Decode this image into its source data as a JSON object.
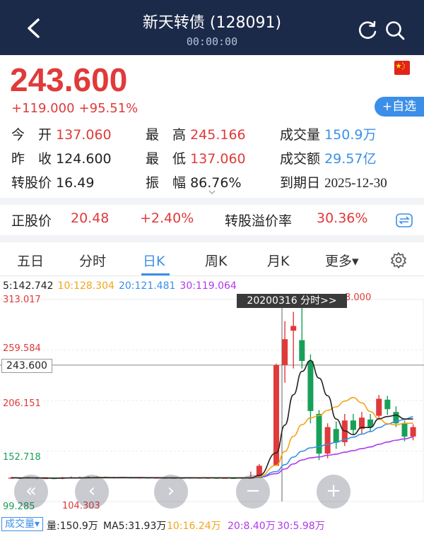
{
  "header": {
    "title": "新天转债 (128091)",
    "subtitle": "00:00:00"
  },
  "quote": {
    "price": "243.600",
    "change": "+119.000",
    "change_pct": "+95.51%",
    "watch_label": "+自选"
  },
  "stats": {
    "open_label": "今　开",
    "open": "137.060",
    "high_label": "最　高",
    "high": "245.166",
    "volume_label": "成交量",
    "volume": "150.9万",
    "prev_label": "昨　收",
    "prev": "124.600",
    "low_label": "最　低",
    "low": "137.060",
    "amount_label": "成交额",
    "amount": "29.57亿",
    "conv_label": "转股价",
    "conv": "16.49",
    "amp_label": "振　幅",
    "amp": "86.76%",
    "expire_label": "到期日",
    "expire": "2025-12-30"
  },
  "stock": {
    "label": "正股价",
    "price": "20.48",
    "pct": "+2.40%",
    "premium_label": "转股溢价率",
    "premium": "30.36%"
  },
  "tabs": [
    {
      "label": "五日"
    },
    {
      "label": "分时"
    },
    {
      "label": "日K"
    },
    {
      "label": "周K"
    },
    {
      "label": "月K"
    },
    {
      "label": "更多▾"
    }
  ],
  "ma": {
    "ma5": "5:142.742",
    "ma10": "10:128.304",
    "ma20": "20:121.481",
    "ma30": "30:119.064"
  },
  "axis": {
    "y1": "313.017",
    "y2": "259.584",
    "y3": "206.151",
    "y4": "152.718",
    "y5": "99.285",
    "low_mark": "104.303",
    "high_mark": "3.000",
    "current": "243.600",
    "date_tip": "20200316 分时>>"
  },
  "volume_bar": {
    "btn": "成交量▾",
    "vol": "量:150.9万",
    "ma5": "MA5:31.93万",
    "ma10": "10:16.24万",
    "ma20": "20:8.40万",
    "ma30": "30:5.98万"
  },
  "colors": {
    "up": "#e03a3a",
    "down": "#18a058",
    "ma5": "#222222",
    "ma10": "#f2a51a",
    "ma20": "#3b8fe8",
    "ma30": "#b03ae8"
  },
  "chart_data": {
    "type": "candlestick",
    "ylim": [
      99.285,
      313.017
    ],
    "candles": [
      {
        "o": 124.3,
        "c": 124.5,
        "h": 125.2,
        "l": 123.6
      },
      {
        "o": 124.5,
        "c": 123.9,
        "h": 125.0,
        "l": 123.2
      },
      {
        "o": 123.9,
        "c": 124.8,
        "h": 125.4,
        "l": 123.4
      },
      {
        "o": 124.8,
        "c": 123.6,
        "h": 125.1,
        "l": 123.0
      },
      {
        "o": 123.6,
        "c": 124.2,
        "h": 124.9,
        "l": 123.1
      },
      {
        "o": 124.2,
        "c": 123.4,
        "h": 124.6,
        "l": 122.8
      },
      {
        "o": 123.4,
        "c": 124.6,
        "h": 125.2,
        "l": 122.9
      },
      {
        "o": 124.6,
        "c": 125.0,
        "h": 125.8,
        "l": 124.0
      },
      {
        "o": 125.0,
        "c": 124.0,
        "h": 125.6,
        "l": 123.5
      },
      {
        "o": 124.0,
        "c": 125.2,
        "h": 125.9,
        "l": 123.6
      },
      {
        "o": 125.2,
        "c": 124.4,
        "h": 125.7,
        "l": 123.9
      },
      {
        "o": 124.4,
        "c": 125.0,
        "h": 125.6,
        "l": 124.0
      },
      {
        "o": 125.0,
        "c": 124.3,
        "h": 125.5,
        "l": 123.8
      },
      {
        "o": 124.3,
        "c": 124.9,
        "h": 125.4,
        "l": 123.9
      },
      {
        "o": 124.9,
        "c": 124.1,
        "h": 125.3,
        "l": 123.7
      },
      {
        "o": 124.1,
        "c": 124.7,
        "h": 125.2,
        "l": 123.5
      },
      {
        "o": 124.7,
        "c": 124.2,
        "h": 125.0,
        "l": 123.6
      },
      {
        "o": 124.2,
        "c": 124.6,
        "h": 125.1,
        "l": 123.7
      },
      {
        "o": 124.6,
        "c": 124.0,
        "h": 124.9,
        "l": 123.4
      },
      {
        "o": 124.0,
        "c": 124.5,
        "h": 125.0,
        "l": 123.5
      },
      {
        "o": 124.5,
        "c": 124.2,
        "h": 124.9,
        "l": 123.6
      },
      {
        "o": 124.2,
        "c": 124.6,
        "h": 125.0,
        "l": 123.7
      },
      {
        "o": 124.6,
        "c": 124.1,
        "h": 124.9,
        "l": 123.5
      },
      {
        "o": 124.1,
        "c": 124.5,
        "h": 124.9,
        "l": 123.6
      },
      {
        "o": 124.5,
        "c": 124.0,
        "h": 124.8,
        "l": 123.4
      },
      {
        "o": 124.0,
        "c": 124.4,
        "h": 124.8,
        "l": 123.6
      },
      {
        "o": 124.4,
        "c": 123.9,
        "h": 124.7,
        "l": 123.3
      },
      {
        "o": 123.9,
        "c": 124.6,
        "h": 125.0,
        "l": 123.5
      },
      {
        "o": 124.6,
        "c": 124.6,
        "h": 131.0,
        "l": 123.9
      },
      {
        "o": 124.6,
        "c": 137.06,
        "h": 139.0,
        "l": 124.2
      },
      {
        "o": 137.06,
        "c": 243.6,
        "h": 245.166,
        "l": 137.06
      },
      {
        "o": 243.6,
        "c": 271.0,
        "h": 290.0,
        "l": 225.0
      },
      {
        "o": 280.0,
        "c": 285.0,
        "h": 300.0,
        "l": 240.0
      },
      {
        "o": 270.0,
        "c": 248.0,
        "h": 310.0,
        "l": 240.0
      },
      {
        "o": 248.0,
        "c": 195.0,
        "h": 255.0,
        "l": 182.0
      },
      {
        "o": 192.0,
        "c": 150.0,
        "h": 196.0,
        "l": 143.0
      },
      {
        "o": 150.0,
        "c": 178.0,
        "h": 182.0,
        "l": 145.0
      },
      {
        "o": 176.0,
        "c": 162.0,
        "h": 184.0,
        "l": 155.0
      },
      {
        "o": 162.0,
        "c": 185.0,
        "h": 192.0,
        "l": 158.0
      },
      {
        "o": 185.0,
        "c": 175.0,
        "h": 192.0,
        "l": 170.0
      },
      {
        "o": 176.0,
        "c": 188.0,
        "h": 194.0,
        "l": 171.0
      },
      {
        "o": 186.0,
        "c": 178.0,
        "h": 192.0,
        "l": 173.0
      },
      {
        "o": 190.0,
        "c": 208.0,
        "h": 212.0,
        "l": 186.0
      },
      {
        "o": 207.0,
        "c": 197.0,
        "h": 211.0,
        "l": 191.0
      },
      {
        "o": 194.0,
        "c": 182.0,
        "h": 200.0,
        "l": 178.0
      },
      {
        "o": 182.0,
        "c": 168.0,
        "h": 185.0,
        "l": 163.0
      },
      {
        "o": 168.0,
        "c": 178.0,
        "h": 181.0,
        "l": 164.0
      }
    ]
  }
}
